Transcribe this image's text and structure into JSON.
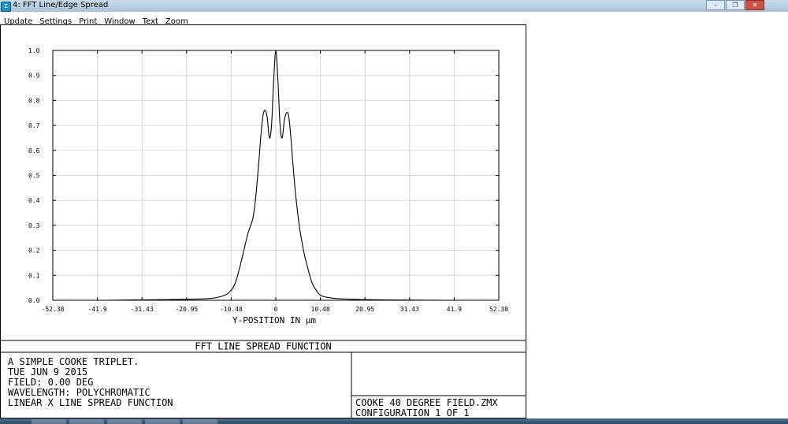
{
  "window": {
    "title": "4: FFT Line/Edge Spread",
    "icon": "zemax-app-icon",
    "controls": [
      "minimize",
      "restore",
      "close"
    ]
  },
  "menu": {
    "update": "Update",
    "settings": "Settings",
    "print": "Print",
    "window": "Window",
    "text": "Text",
    "zoom": "Zoom"
  },
  "chart_data": {
    "type": "line",
    "title": "FFT LINE SPREAD FUNCTION",
    "xlabel": "Y-POSITION IN µm",
    "ylabel": "",
    "xlim": [
      -52.38,
      52.38
    ],
    "ylim": [
      0.0,
      1.0
    ],
    "xticks": [
      "-52.38",
      "-41.9",
      "-31.43",
      "-20.95",
      "-10.48",
      "0",
      "10.48",
      "20.95",
      "31.43",
      "41.9",
      "52.38"
    ],
    "yticks": [
      "0.0",
      "0.1",
      "0.2",
      "0.3",
      "0.4",
      "0.5",
      "0.6",
      "0.7",
      "0.8",
      "0.9",
      "1.0"
    ],
    "grid": true,
    "series": [
      {
        "x": [
          -52.38,
          -40,
          -30,
          -20,
          -15,
          -12,
          -10.5,
          -9.5,
          -8.5,
          -7.5,
          -6.5,
          -5.5,
          -5,
          -4.5,
          -4,
          -3.5,
          -3,
          -2.5,
          -2,
          -1.5,
          -1,
          -0.5,
          0,
          0.5,
          1,
          1.5,
          2,
          2.5,
          3,
          3.5,
          4,
          4.5,
          5,
          5.5,
          6.5,
          7.5,
          8.5,
          9.5,
          10.5,
          12,
          15,
          20,
          30,
          40,
          52.38
        ],
        "y": [
          0.0,
          0.0,
          0.002,
          0.004,
          0.008,
          0.02,
          0.04,
          0.07,
          0.13,
          0.2,
          0.27,
          0.32,
          0.37,
          0.45,
          0.55,
          0.66,
          0.74,
          0.76,
          0.73,
          0.65,
          0.7,
          0.88,
          1.0,
          0.88,
          0.7,
          0.65,
          0.72,
          0.75,
          0.74,
          0.66,
          0.55,
          0.45,
          0.37,
          0.3,
          0.2,
          0.13,
          0.07,
          0.04,
          0.02,
          0.012,
          0.006,
          0.003,
          0.001,
          0.0,
          0.0
        ],
        "color": "#000000"
      }
    ]
  },
  "info": {
    "lines": [
      "A SIMPLE COOKE TRIPLET.",
      "TUE JUN 9 2015",
      "FIELD: 0.00 DEG",
      "WAVELENGTH: POLYCHROMATIC",
      "LINEAR X LINE SPREAD FUNCTION"
    ],
    "file": "COOKE 40 DEGREE FIELD.ZMX",
    "configuration": "CONFIGURATION 1 OF 1"
  }
}
